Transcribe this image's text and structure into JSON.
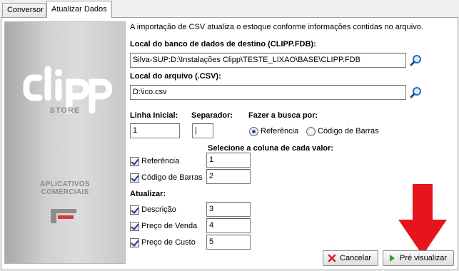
{
  "tabs": [
    {
      "label": "Conversor",
      "active": false
    },
    {
      "label": "Atualizar Dados",
      "active": true
    }
  ],
  "brand": {
    "logo_text": "clipp",
    "store": "STORE",
    "aplicativos_line1": "APLICATIVOS",
    "aplicativos_line2": "COMERCIAIS"
  },
  "info_text": "A importação de CSV atualiza o estoque conforme informações contidas no arquivo.",
  "db": {
    "label": "Local do banco de dados de destino (CLIPP.FDB):",
    "value": "Silva-SUP:D:\\Instalações Clipp\\TESTE_LIXAO\\BASE\\CLIPP.FDB"
  },
  "file": {
    "label": "Local do arquivo (.CSV):",
    "value": "D:\\ico.csv"
  },
  "linha_inicial": {
    "label": "Linha Inicial:",
    "value": "1"
  },
  "separador": {
    "label": "Separador:",
    "value": "|"
  },
  "busca": {
    "label": "Fazer a busca por:",
    "options": [
      {
        "label": "Referência",
        "selected": true
      },
      {
        "label": "Código de Barras",
        "selected": false
      }
    ]
  },
  "colunas_label": "Selecione a coluna de cada valor:",
  "identificacao": [
    {
      "label": "Referência",
      "checked": true,
      "column": "1"
    },
    {
      "label": "Código de Barras",
      "checked": true,
      "column": "2"
    }
  ],
  "atualizar": {
    "label": "Atualizar:",
    "items": [
      {
        "label": "Descrição",
        "checked": true,
        "column": "3"
      },
      {
        "label": "Preço de Venda",
        "checked": true,
        "column": "4"
      },
      {
        "label": "Preço de Custo",
        "checked": true,
        "column": "5"
      }
    ]
  },
  "buttons": {
    "cancel": "Cancelar",
    "preview": "Pré visualizar"
  },
  "icons": {
    "search": "magnifier-icon",
    "cancel": "red-x-icon",
    "preview": "green-play-icon",
    "annotation": "red-down-arrow"
  },
  "colors": {
    "annotation_arrow": "#e8141c",
    "cancel_icon": "#d42020",
    "preview_icon": "#2e9e2e"
  }
}
